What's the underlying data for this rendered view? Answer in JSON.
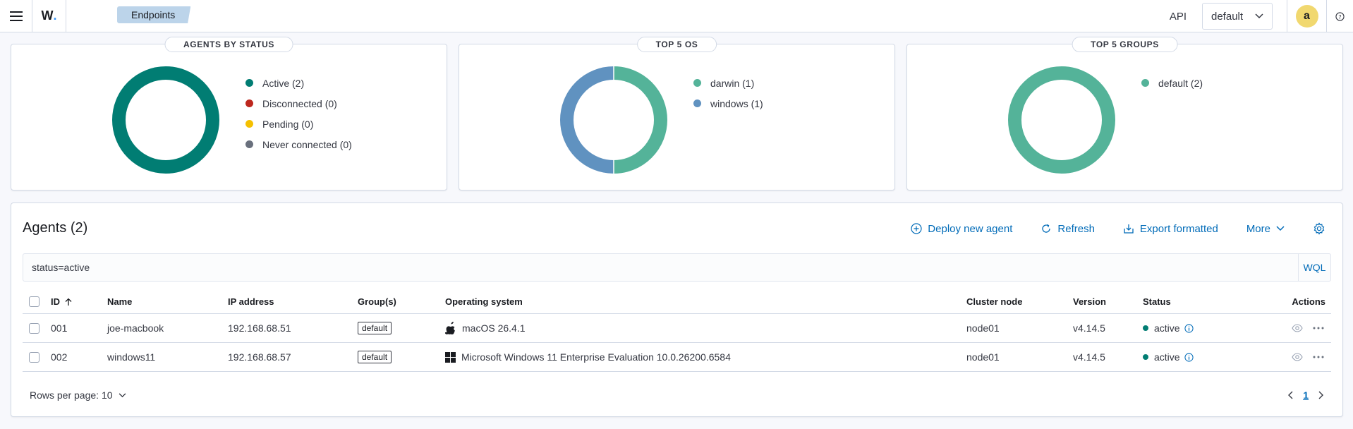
{
  "header": {
    "logo": "W",
    "breadcrumb": "Endpoints",
    "api_label": "API",
    "env_value": "default",
    "avatar_initial": "a"
  },
  "colors": {
    "active": "#017d73",
    "disconnected": "#bd271e",
    "pending": "#f5c000",
    "never_connected": "#69707d",
    "darwin": "#54b399",
    "windows": "#6092c0",
    "default_group": "#54b399",
    "link": "#006bb8"
  },
  "panels": {
    "status": {
      "title": "AGENTS BY STATUS",
      "legend": [
        "Active (2)",
        "Disconnected (0)",
        "Pending (0)",
        "Never connected (0)"
      ]
    },
    "os": {
      "title": "TOP 5 OS",
      "legend": [
        "darwin (1)",
        "windows (1)"
      ]
    },
    "groups": {
      "title": "TOP 5 GROUPS",
      "legend": [
        "default (2)"
      ]
    }
  },
  "chart_data": [
    {
      "type": "pie",
      "title": "AGENTS BY STATUS",
      "categories": [
        "Active",
        "Disconnected",
        "Pending",
        "Never connected"
      ],
      "values": [
        2,
        0,
        0,
        0
      ]
    },
    {
      "type": "pie",
      "title": "TOP 5 OS",
      "categories": [
        "darwin",
        "windows"
      ],
      "values": [
        1,
        1
      ]
    },
    {
      "type": "pie",
      "title": "TOP 5 GROUPS",
      "categories": [
        "default"
      ],
      "values": [
        2
      ]
    }
  ],
  "agents": {
    "title": "Agents (2)",
    "actions": {
      "deploy": "Deploy new agent",
      "refresh": "Refresh",
      "export": "Export formatted",
      "more": "More"
    },
    "search_value": "status=active",
    "wql": "WQL",
    "columns": [
      "ID",
      "Name",
      "IP address",
      "Group(s)",
      "Operating system",
      "Cluster node",
      "Version",
      "Status",
      "Actions"
    ],
    "rows": [
      {
        "id": "001",
        "name": "joe-macbook",
        "ip": "192.168.68.51",
        "group": "default",
        "os_icon": "apple-icon",
        "os": "macOS 26.4.1",
        "node": "node01",
        "version": "v4.14.5",
        "status": "active"
      },
      {
        "id": "002",
        "name": "windows11",
        "ip": "192.168.68.57",
        "group": "default",
        "os_icon": "windows-icon",
        "os": "Microsoft Windows 11 Enterprise Evaluation 10.0.26200.6584",
        "node": "node01",
        "version": "v4.14.5",
        "status": "active"
      }
    ],
    "rows_per_page": "Rows per page: 10",
    "page": "1"
  }
}
